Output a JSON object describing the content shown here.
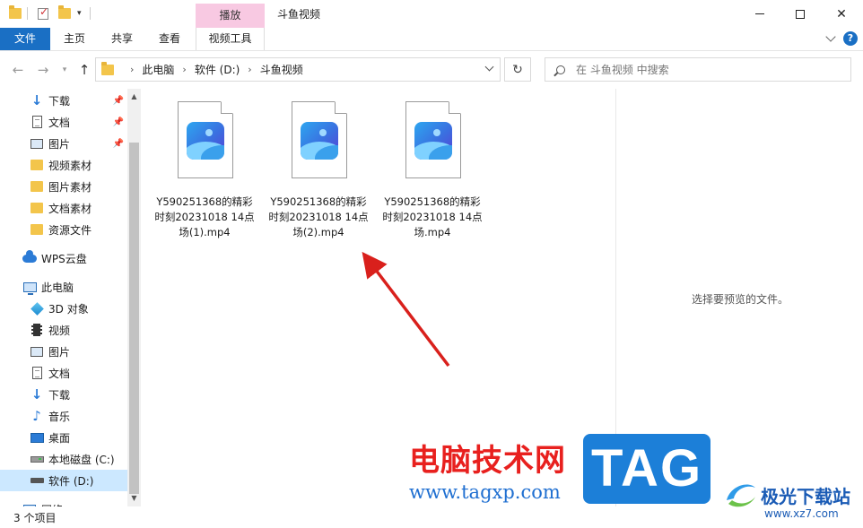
{
  "window": {
    "title": "斗鱼视频",
    "context_tab": "播放",
    "minimize": "—",
    "maximize": "☐",
    "close": "✕"
  },
  "ribbon": {
    "tabs": [
      "文件",
      "主页",
      "共享",
      "查看"
    ],
    "context_tab": "视频工具"
  },
  "address": {
    "crumbs": [
      "此电脑",
      "软件 (D:)",
      "斗鱼视频"
    ]
  },
  "search": {
    "placeholder": "在 斗鱼视频 中搜索"
  },
  "sidebar": {
    "items": [
      {
        "label": "下载",
        "icon": "download-icon",
        "pinned": true
      },
      {
        "label": "文档",
        "icon": "document-icon",
        "pinned": true
      },
      {
        "label": "图片",
        "icon": "picture-icon",
        "pinned": true
      },
      {
        "label": "视频素材",
        "icon": "folder-icon",
        "pinned": false
      },
      {
        "label": "图片素材",
        "icon": "folder-icon",
        "pinned": false
      },
      {
        "label": "文档素材",
        "icon": "folder-icon",
        "pinned": false
      },
      {
        "label": "资源文件",
        "icon": "folder-icon",
        "pinned": false
      },
      {
        "label": "WPS云盘",
        "icon": "cloud-icon",
        "pinned": false
      },
      {
        "label": "此电脑",
        "icon": "computer-icon",
        "pinned": false
      },
      {
        "label": "3D 对象",
        "icon": "3d-objects-icon",
        "pinned": false
      },
      {
        "label": "视频",
        "icon": "video-icon",
        "pinned": false
      },
      {
        "label": "图片",
        "icon": "picture-icon",
        "pinned": false
      },
      {
        "label": "文档",
        "icon": "document-icon",
        "pinned": false
      },
      {
        "label": "下载",
        "icon": "download-icon",
        "pinned": false
      },
      {
        "label": "音乐",
        "icon": "music-icon",
        "pinned": false
      },
      {
        "label": "桌面",
        "icon": "desktop-icon",
        "pinned": false
      },
      {
        "label": "本地磁盘 (C:)",
        "icon": "drive-c-icon",
        "pinned": false
      },
      {
        "label": "软件 (D:)",
        "icon": "drive-d-icon",
        "pinned": false,
        "selected": true
      },
      {
        "label": "网络",
        "icon": "network-icon",
        "pinned": false
      }
    ]
  },
  "files": [
    {
      "name": "Y590251368的精彩时刻20231018 14点场(1).mp4"
    },
    {
      "name": "Y590251368的精彩时刻20231018 14点场(2).mp4"
    },
    {
      "name": "Y590251368的精彩时刻20231018 14点场.mp4"
    }
  ],
  "preview": {
    "message": "选择要预览的文件。"
  },
  "status": {
    "count": "3 个项目"
  },
  "watermark": {
    "site_cn": "电脑技术网",
    "site_url": "www.tagxp.com",
    "tag": "TAG",
    "jg_name": "极光下载站",
    "jg_url": "www.xz7.com"
  },
  "colors": {
    "accent": "#1a6fc4",
    "context_tab": "#f8c9e2",
    "selected": "#cce8ff",
    "arrow": "#d9201c"
  }
}
